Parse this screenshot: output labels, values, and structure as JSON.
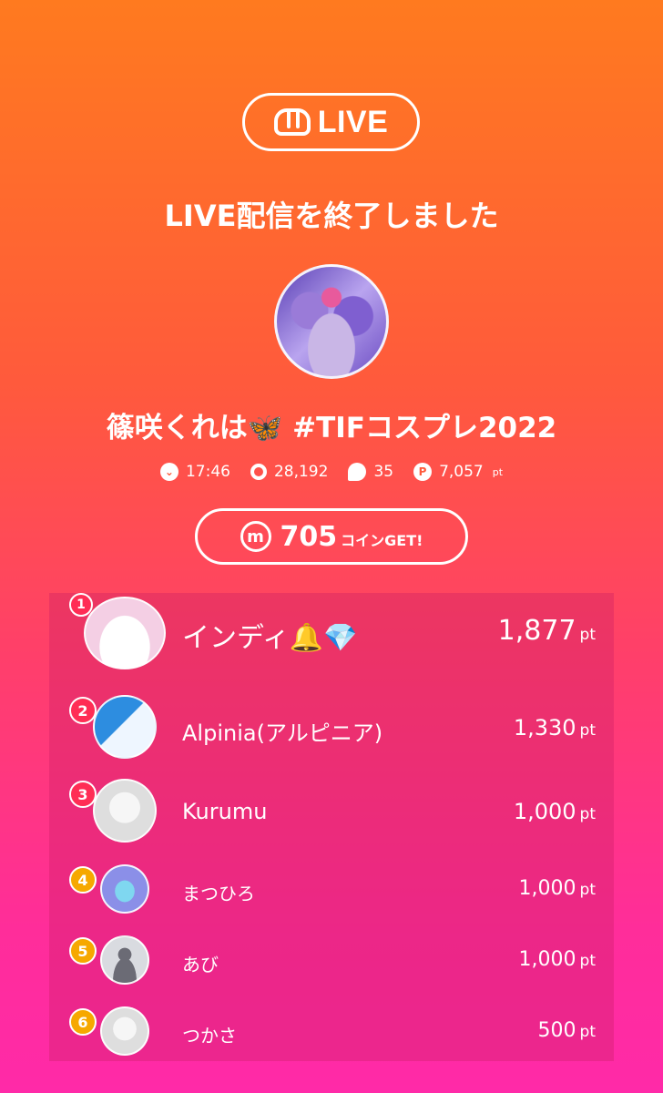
{
  "header": {
    "logo_text": "LIVE",
    "end_title": "LIVE配信を終了しました"
  },
  "streamer": {
    "name": "篠咲くれは🦋 #TIFコスプレ2022"
  },
  "stats": {
    "time": "17:46",
    "viewers": "28,192",
    "comments": "35",
    "points": "7,057",
    "points_unit": "pt"
  },
  "coins": {
    "icon_letter": "m",
    "amount": "705",
    "suffix": "コインGET!"
  },
  "ranking": [
    {
      "rank": "1",
      "name": "インディ🔔💎",
      "points": "1,877",
      "unit": "pt",
      "badge_color": "#ff2d55"
    },
    {
      "rank": "2",
      "name": "Alpinia(アルピニア)",
      "points": "1,330",
      "unit": "pt",
      "badge_color": "#ff2d55"
    },
    {
      "rank": "3",
      "name": "Kurumu",
      "points": "1,000",
      "unit": "pt",
      "badge_color": "#ff2d55"
    },
    {
      "rank": "4",
      "name": "まつひろ",
      "points": "1,000",
      "unit": "pt",
      "badge_color": "#f6a800"
    },
    {
      "rank": "5",
      "name": "あび",
      "points": "1,000",
      "unit": "pt",
      "badge_color": "#f6a800"
    },
    {
      "rank": "6",
      "name": "つかさ",
      "points": "500",
      "unit": "pt",
      "badge_color": "#f6a800"
    }
  ],
  "colors": {
    "gradient_top": "#ff7a1f",
    "gradient_bottom": "#ff2aa8"
  }
}
